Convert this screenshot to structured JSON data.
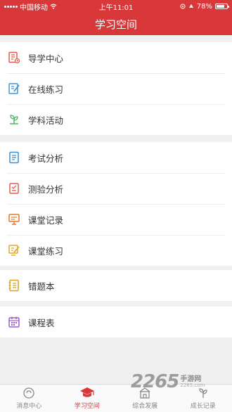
{
  "status_bar": {
    "carrier": "中国移动",
    "time": "上午11:01",
    "battery_percent": "78%",
    "battery_level": 0.78
  },
  "nav": {
    "title": "学习空间"
  },
  "groups": [
    {
      "items": [
        {
          "label": "导学中心",
          "icon": "guide-doc-icon",
          "color": "#e25b4f"
        },
        {
          "label": "在线练习",
          "icon": "edit-icon",
          "color": "#3a9ad9"
        },
        {
          "label": "学科活动",
          "icon": "sprout-icon",
          "color": "#55b36a"
        }
      ]
    },
    {
      "items": [
        {
          "label": "考试分析",
          "icon": "document-icon",
          "color": "#3a8fd9"
        },
        {
          "label": "测验分析",
          "icon": "checklist-icon",
          "color": "#e25b4f"
        },
        {
          "label": "课堂记录",
          "icon": "board-icon",
          "color": "#e07a2f"
        },
        {
          "label": "课堂练习",
          "icon": "edit-icon",
          "color": "#e2a82c"
        }
      ]
    },
    {
      "items": [
        {
          "label": "错题本",
          "icon": "notebook-icon",
          "color": "#d9a02b"
        }
      ]
    },
    {
      "items": [
        {
          "label": "课程表",
          "icon": "calendar-icon",
          "color": "#a05cc9"
        }
      ]
    }
  ],
  "tabs": [
    {
      "label": "消息中心",
      "icon": "message-icon",
      "active": false
    },
    {
      "label": "学习空间",
      "icon": "graduation-cap-icon",
      "active": true
    },
    {
      "label": "综合发展",
      "icon": "building-icon",
      "active": false
    },
    {
      "label": "成长记录",
      "icon": "growth-icon",
      "active": false
    }
  ],
  "watermark": {
    "number": "2265",
    "cn": "手游网",
    "url": "2265.com"
  },
  "colors": {
    "accent": "#d9383b",
    "background": "#f0f0f0"
  }
}
